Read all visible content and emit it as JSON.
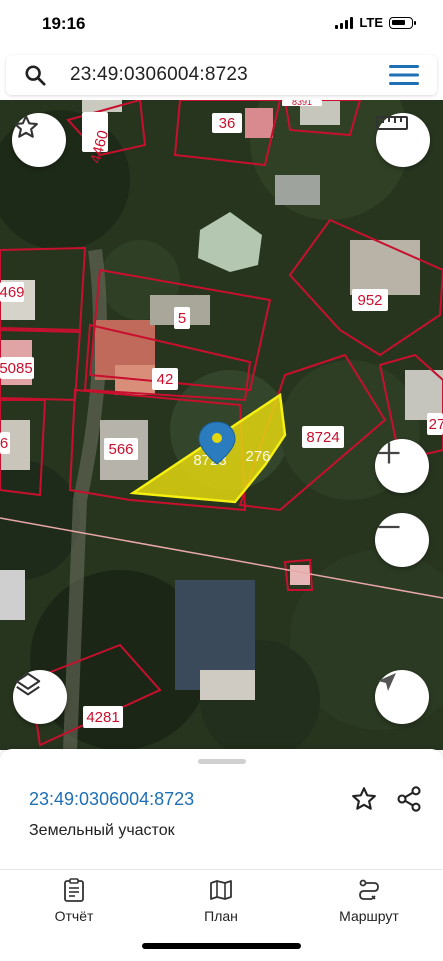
{
  "status": {
    "time": "19:16",
    "network": "LTE"
  },
  "search": {
    "query": "23:49:0306004:8723"
  },
  "map": {
    "parcel_labels": [
      "4460",
      "36",
      "8391",
      "469",
      "952",
      "5",
      "42",
      "5085",
      "8724",
      "566",
      "8723",
      "276",
      "27",
      "4281",
      "6"
    ],
    "highlight_color": "#e3d70f",
    "border_color": "#c8102e"
  },
  "sheet": {
    "parcel_id": "23:49:0306004:8723",
    "parcel_type": "Земельный участок"
  },
  "tabs": [
    {
      "label": "Отчёт"
    },
    {
      "label": "План"
    },
    {
      "label": "Маршрут"
    }
  ]
}
